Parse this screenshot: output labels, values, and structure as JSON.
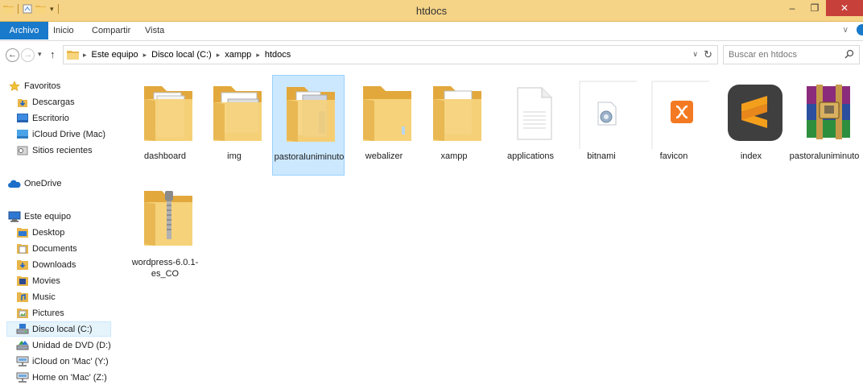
{
  "window": {
    "title": "htdocs"
  },
  "ribbon": {
    "tabs": [
      "Archivo",
      "Inicio",
      "Compartir",
      "Vista"
    ]
  },
  "address": {
    "crumbs": [
      "Este equipo",
      "Disco local (C:)",
      "xampp",
      "htdocs"
    ]
  },
  "search": {
    "placeholder": "Buscar en htdocs"
  },
  "navpane": {
    "favorites": {
      "label": "Favoritos",
      "items": [
        "Descargas",
        "Escritorio",
        "iCloud Drive (Mac)",
        "Sitios recientes"
      ]
    },
    "onedrive": "OneDrive",
    "computer": {
      "label": "Este equipo",
      "items": [
        "Desktop",
        "Documents",
        "Downloads",
        "Movies",
        "Music",
        "Pictures",
        "Disco local (C:)",
        "Unidad de DVD (D:)",
        "iCloud on 'Mac' (Y:)",
        "Home on 'Mac' (Z:)"
      ],
      "selected": "Disco local (C:)"
    }
  },
  "files": [
    {
      "name": "dashboard",
      "kind": "folder-icon"
    },
    {
      "name": "img",
      "kind": "folder-icon"
    },
    {
      "name": "pastoraluniminuto",
      "kind": "folder-icon",
      "selected": true
    },
    {
      "name": "webalizer",
      "kind": "folder-icon"
    },
    {
      "name": "xampp",
      "kind": "folder-icon"
    },
    {
      "name": "applications",
      "kind": "document-icon"
    },
    {
      "name": "bitnami",
      "kind": "css-file-icon"
    },
    {
      "name": "favicon",
      "kind": "xampp-icon"
    },
    {
      "name": "index",
      "kind": "sublime-text-icon"
    },
    {
      "name": "pastoraluniminuto",
      "kind": "winrar-archive-icon"
    },
    {
      "name": "wordpress-6.0.1-es_CO",
      "kind": "zip-folder-icon"
    }
  ],
  "colors": {
    "titlebar": "#f5d387",
    "file_tab": "#1979ca",
    "selection": "#cce8ff",
    "close_button": "#c7403a"
  }
}
